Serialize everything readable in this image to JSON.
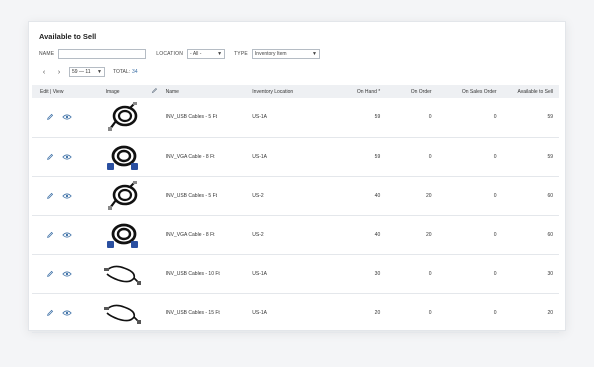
{
  "panel": {
    "title": "Available to Sell"
  },
  "filters": {
    "name_label": "NAME",
    "name_value": "",
    "location_label": "LOCATION",
    "location_value": "- All -",
    "type_label": "TYPE",
    "type_value": "Inventory Item"
  },
  "pager": {
    "prev": "‹",
    "next": "›",
    "range": "59 — 11",
    "total_label": "TOTAL:",
    "total_value": "34"
  },
  "table": {
    "headers": {
      "edit_view": "Edit | View",
      "image": "Image",
      "name": "Name",
      "location": "Inventory Location",
      "on_hand": "On Hand *",
      "on_order": "On Order",
      "on_sales_order": "On Sales Order",
      "available": "Available to Sell"
    },
    "rows": [
      {
        "image": "usb-cable-image",
        "name": "INV_USB Cables - 5 Ft",
        "location": "US-1A",
        "on_hand": "59",
        "on_order": "0",
        "on_sales_order": "0",
        "available": "59"
      },
      {
        "image": "vga-cable-image",
        "name": "INV_VGA Cable - 8 Ft",
        "location": "US-1A",
        "on_hand": "59",
        "on_order": "0",
        "on_sales_order": "0",
        "available": "59"
      },
      {
        "image": "usb-cable-image",
        "name": "INV_USB Cables - 5 Ft",
        "location": "US-2",
        "on_hand": "40",
        "on_order": "20",
        "on_sales_order": "0",
        "available": "60"
      },
      {
        "image": "vga-cable-image",
        "name": "INV_VGA Cable - 8 Ft",
        "location": "US-2",
        "on_hand": "40",
        "on_order": "20",
        "on_sales_order": "0",
        "available": "60"
      },
      {
        "image": "usb-cable-image",
        "name": "INV_USB Cables - 10 Ft",
        "location": "US-1A",
        "on_hand": "30",
        "on_order": "0",
        "on_sales_order": "0",
        "available": "30"
      },
      {
        "image": "usb-cable-image",
        "name": "INV_USB Cables - 15 Ft",
        "location": "US-1A",
        "on_hand": "20",
        "on_order": "0",
        "on_sales_order": "0",
        "available": "20"
      }
    ]
  },
  "colors": {
    "accent": "#3a6ea5",
    "header_bg": "#eef0f3",
    "vga_connector": "#2a4fa0"
  }
}
